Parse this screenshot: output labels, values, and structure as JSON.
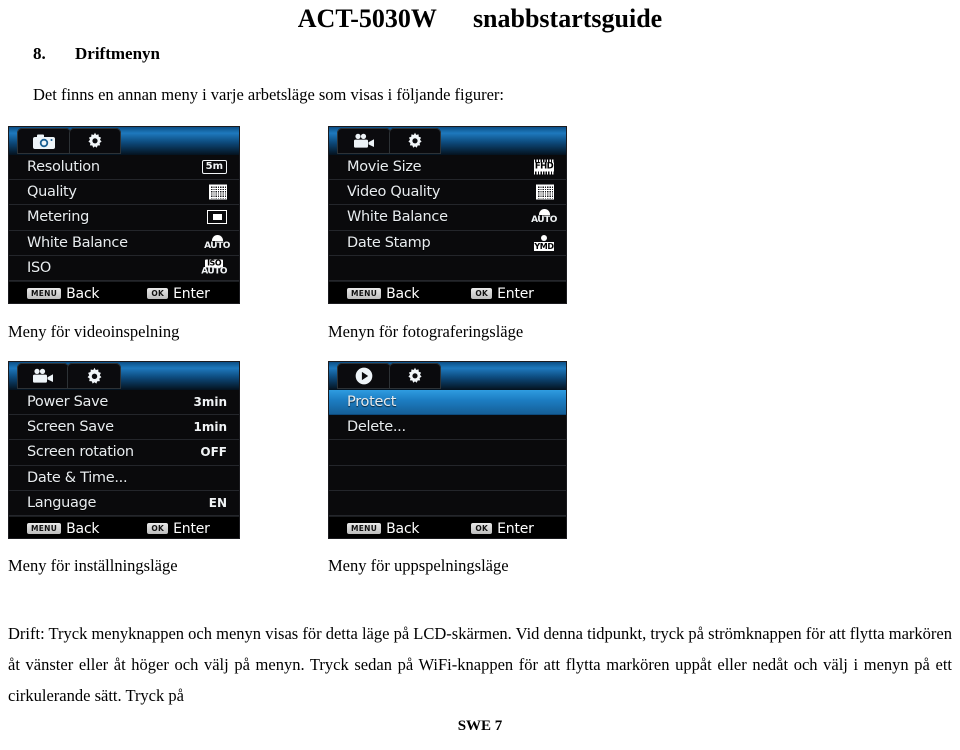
{
  "header": {
    "model": "ACT-5030W",
    "doc_type": "snabbstartsguide"
  },
  "section": {
    "number": "8.",
    "title": "Driftmenyn",
    "intro": "Det finns en annan meny i varje arbetsläge som visas i följande figurer:"
  },
  "panels": [
    {
      "id": "video-recording-menu",
      "caption": "Meny för videoinspelning",
      "tabs": [
        "camera-icon",
        "gear-icon"
      ],
      "active_tab": 0,
      "rows": [
        {
          "label": "Resolution",
          "value": "5m",
          "value_icon": "resolution-5m-icon"
        },
        {
          "label": "Quality",
          "value": "",
          "value_icon": "quality-grid-icon"
        },
        {
          "label": "Metering",
          "value": "",
          "value_icon": "metering-icon"
        },
        {
          "label": "White Balance",
          "value": "AUTO",
          "value_icon": "white-balance-auto-icon"
        },
        {
          "label": "ISO",
          "value": "AUTO",
          "value_icon": "iso-auto-icon"
        }
      ],
      "footer": {
        "back_key": "MENU",
        "back_label": "Back",
        "enter_key": "OK",
        "enter_label": "Enter"
      }
    },
    {
      "id": "photo-mode-menu",
      "caption": "Menyn för fotograferingsläge",
      "tabs": [
        "video-camera-icon",
        "gear-icon"
      ],
      "active_tab": 0,
      "rows": [
        {
          "label": "Movie Size",
          "value": "FHD",
          "value_icon": "movie-size-fhd-icon"
        },
        {
          "label": "Video Quality",
          "value": "",
          "value_icon": "quality-grid-icon"
        },
        {
          "label": "White Balance",
          "value": "AUTO",
          "value_icon": "white-balance-auto-icon"
        },
        {
          "label": "Date Stamp",
          "value": "YMD",
          "value_icon": "date-stamp-ymd-icon"
        },
        {
          "label": "",
          "value": "",
          "value_icon": ""
        }
      ],
      "footer": {
        "back_key": "MENU",
        "back_label": "Back",
        "enter_key": "OK",
        "enter_label": "Enter"
      }
    },
    {
      "id": "settings-mode-menu",
      "caption": "Meny för inställningsläge",
      "tabs": [
        "video-camera-icon",
        "gear-icon"
      ],
      "active_tab": 1,
      "rows": [
        {
          "label": "Power Save",
          "value": "3min",
          "value_icon": ""
        },
        {
          "label": "Screen Save",
          "value": "1min",
          "value_icon": ""
        },
        {
          "label": "Screen rotation",
          "value": "OFF",
          "value_icon": ""
        },
        {
          "label": "Date & Time...",
          "value": "",
          "value_icon": ""
        },
        {
          "label": "Language",
          "value": "EN",
          "value_icon": ""
        }
      ],
      "footer": {
        "back_key": "MENU",
        "back_label": "Back",
        "enter_key": "OK",
        "enter_label": "Enter"
      }
    },
    {
      "id": "playback-mode-menu",
      "caption": "Meny för uppspelningsläge",
      "tabs": [
        "play-icon",
        "gear-icon"
      ],
      "active_tab": 0,
      "rows": [
        {
          "label": "Protect",
          "value": "",
          "value_icon": "",
          "selected": true
        },
        {
          "label": "Delete...",
          "value": "",
          "value_icon": ""
        },
        {
          "label": "",
          "value": "",
          "value_icon": ""
        },
        {
          "label": "",
          "value": "",
          "value_icon": ""
        },
        {
          "label": "",
          "value": "",
          "value_icon": ""
        }
      ],
      "footer": {
        "back_key": "MENU",
        "back_label": "Back",
        "enter_key": "OK",
        "enter_label": "Enter"
      }
    }
  ],
  "body": {
    "paragraph": "Drift: Tryck menyknappen och menyn visas för detta läge på LCD-skärmen. Vid denna tidpunkt, tryck på strömknappen för att flytta markören åt vänster eller åt höger och välj på menyn. Tryck sedan på WiFi-knappen för att flytta markören uppåt eller nedåt och välj i menyn på ett cirkulerande sätt. Tryck på"
  },
  "footer": {
    "page_label": "SWE 7"
  },
  "colors": {
    "lcd_background": "#0a0a0c",
    "tab_strip_blue": "#1e79bd",
    "selection_blue": "#1d7ec4",
    "row_divider": "#24262b",
    "text_white": "#e8ecef"
  }
}
